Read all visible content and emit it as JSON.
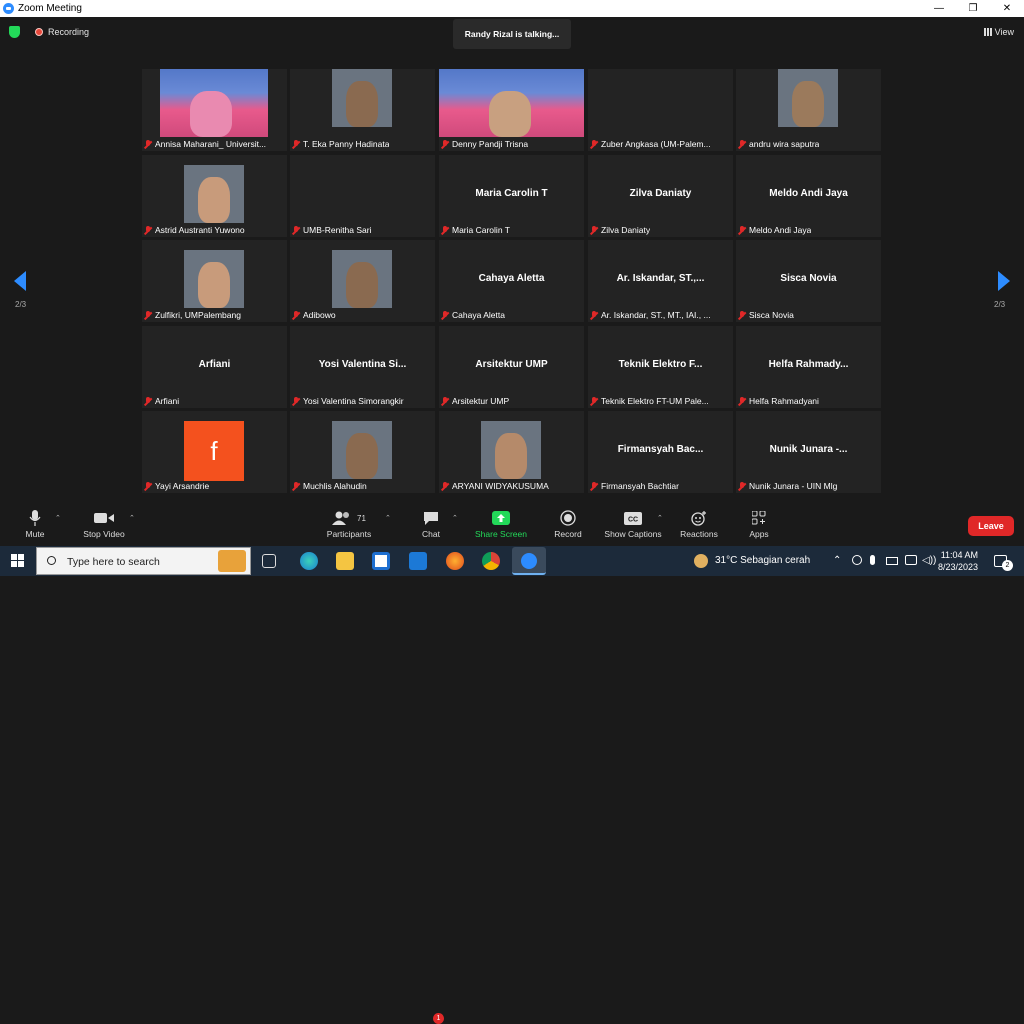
{
  "window": {
    "title": "Zoom Meeting",
    "controls": [
      "—",
      "❐",
      "✕"
    ]
  },
  "meeting": {
    "recording_label": "Recording",
    "talking_banner": "Randy Rizal is talking...",
    "view_label": "View",
    "page_indicator_left": "2/3",
    "page_indicator_right": "2/3"
  },
  "participants_tiles": [
    {
      "name": "Annisa Maharani_ Universit...",
      "video": "banner"
    },
    {
      "name": "T. Eka Panny Hadinata",
      "video": "person"
    },
    {
      "name": "Denny Pandji Trisna",
      "video": "banner"
    },
    {
      "name": "Zuber Angkasa (UM-Palem...",
      "video": "none"
    },
    {
      "name": "andru wira saputra",
      "video": "person"
    },
    {
      "name": "Astrid Austranti Yuwono",
      "video": "person"
    },
    {
      "name": "UMB-Renitha Sari",
      "video": "none"
    },
    {
      "name": "Maria Carolin T",
      "big": "Maria Carolin T"
    },
    {
      "name": "Zilva Daniaty",
      "big": "Zilva Daniaty"
    },
    {
      "name": "Meldo Andi Jaya",
      "big": "Meldo Andi Jaya"
    },
    {
      "name": "Zulfikri, UMPalembang",
      "video": "person"
    },
    {
      "name": "Adibowo",
      "video": "person"
    },
    {
      "name": "Cahaya Aletta",
      "big": "Cahaya Aletta"
    },
    {
      "name": "Ar. Iskandar, ST., MT., IAI., ...",
      "big": "Ar. Iskandar, ST.,..."
    },
    {
      "name": "Sisca Novia",
      "big": "Sisca Novia"
    },
    {
      "name": "Arfiani",
      "big": "Arfiani"
    },
    {
      "name": "Yosi Valentina Simorangkir",
      "big": "Yosi  Valentina  Si..."
    },
    {
      "name": "Arsitektur UMP",
      "big": "Arsitektur UMP"
    },
    {
      "name": "Teknik Elektro FT-UM Pale...",
      "big": "Teknik  Elektro  F..."
    },
    {
      "name": "Helfa Rahmadyani",
      "big": "Helfa  Rahmady..."
    },
    {
      "name": "Yayi Arsandrie",
      "video": "letter",
      "letter": "f"
    },
    {
      "name": "Muchlis Alahudin",
      "video": "person"
    },
    {
      "name": "ARYANI WIDYAKUSUMA",
      "video": "person"
    },
    {
      "name": "Firmansyah Bachtiar",
      "big": "Firmansyah  Bac..."
    },
    {
      "name": "Nunik Junara - UIN Mlg",
      "big": "Nunik  Junara  -..."
    }
  ],
  "toolbar": {
    "mute": "Mute",
    "stop_video": "Stop Video",
    "participants": "Participants",
    "participants_count": "71",
    "chat": "Chat",
    "chat_badge": "1",
    "share_screen": "Share Screen",
    "record": "Record",
    "show_captions": "Show Captions",
    "reactions": "Reactions",
    "apps": "Apps",
    "leave": "Leave"
  },
  "taskbar": {
    "search_placeholder": "Type here to search",
    "weather": "31°C  Sebagian cerah",
    "time": "11:04 AM",
    "date": "8/23/2023",
    "notif_count": "2"
  },
  "colors": {
    "accent": "#2d8cff",
    "leave": "#e02828",
    "share": "#23d959"
  }
}
